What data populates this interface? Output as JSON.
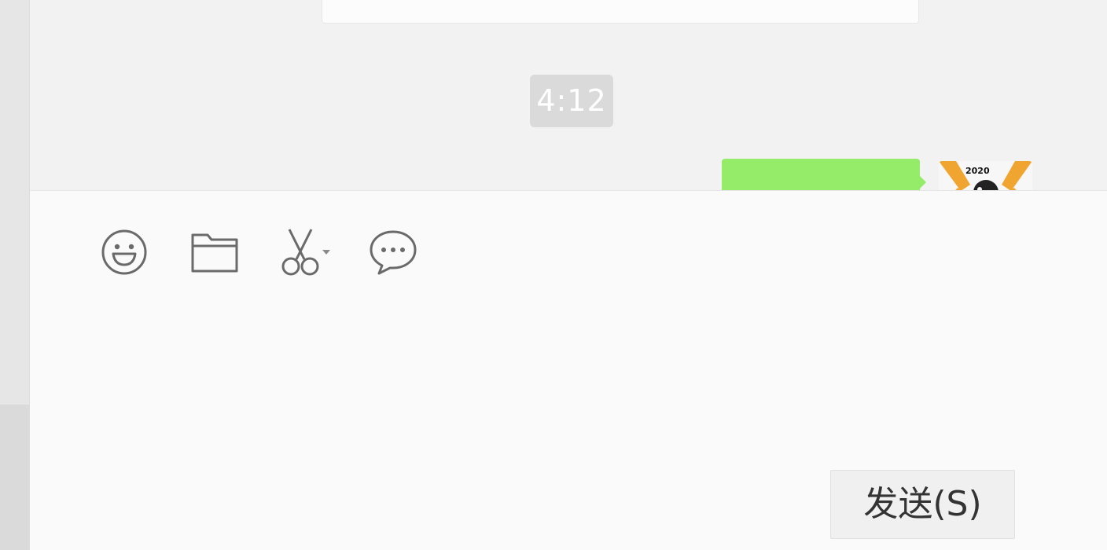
{
  "chat": {
    "timestamp": "4:12"
  },
  "toolbar": {
    "items": [
      {
        "name": "emoji",
        "icon": "smiley-face-icon"
      },
      {
        "name": "file",
        "icon": "folder-icon"
      },
      {
        "name": "screenshot",
        "icon": "scissors-icon"
      },
      {
        "name": "chat-history",
        "icon": "speech-bubble-icon"
      }
    ]
  },
  "composer": {
    "send_label": "发送(S)"
  },
  "colors": {
    "my_bubble": "#95ec69",
    "timestamp_bg": "#dadada",
    "chat_bg": "#f2f2f2",
    "input_bg": "#fafafa",
    "icon": "#6a6a6a"
  }
}
